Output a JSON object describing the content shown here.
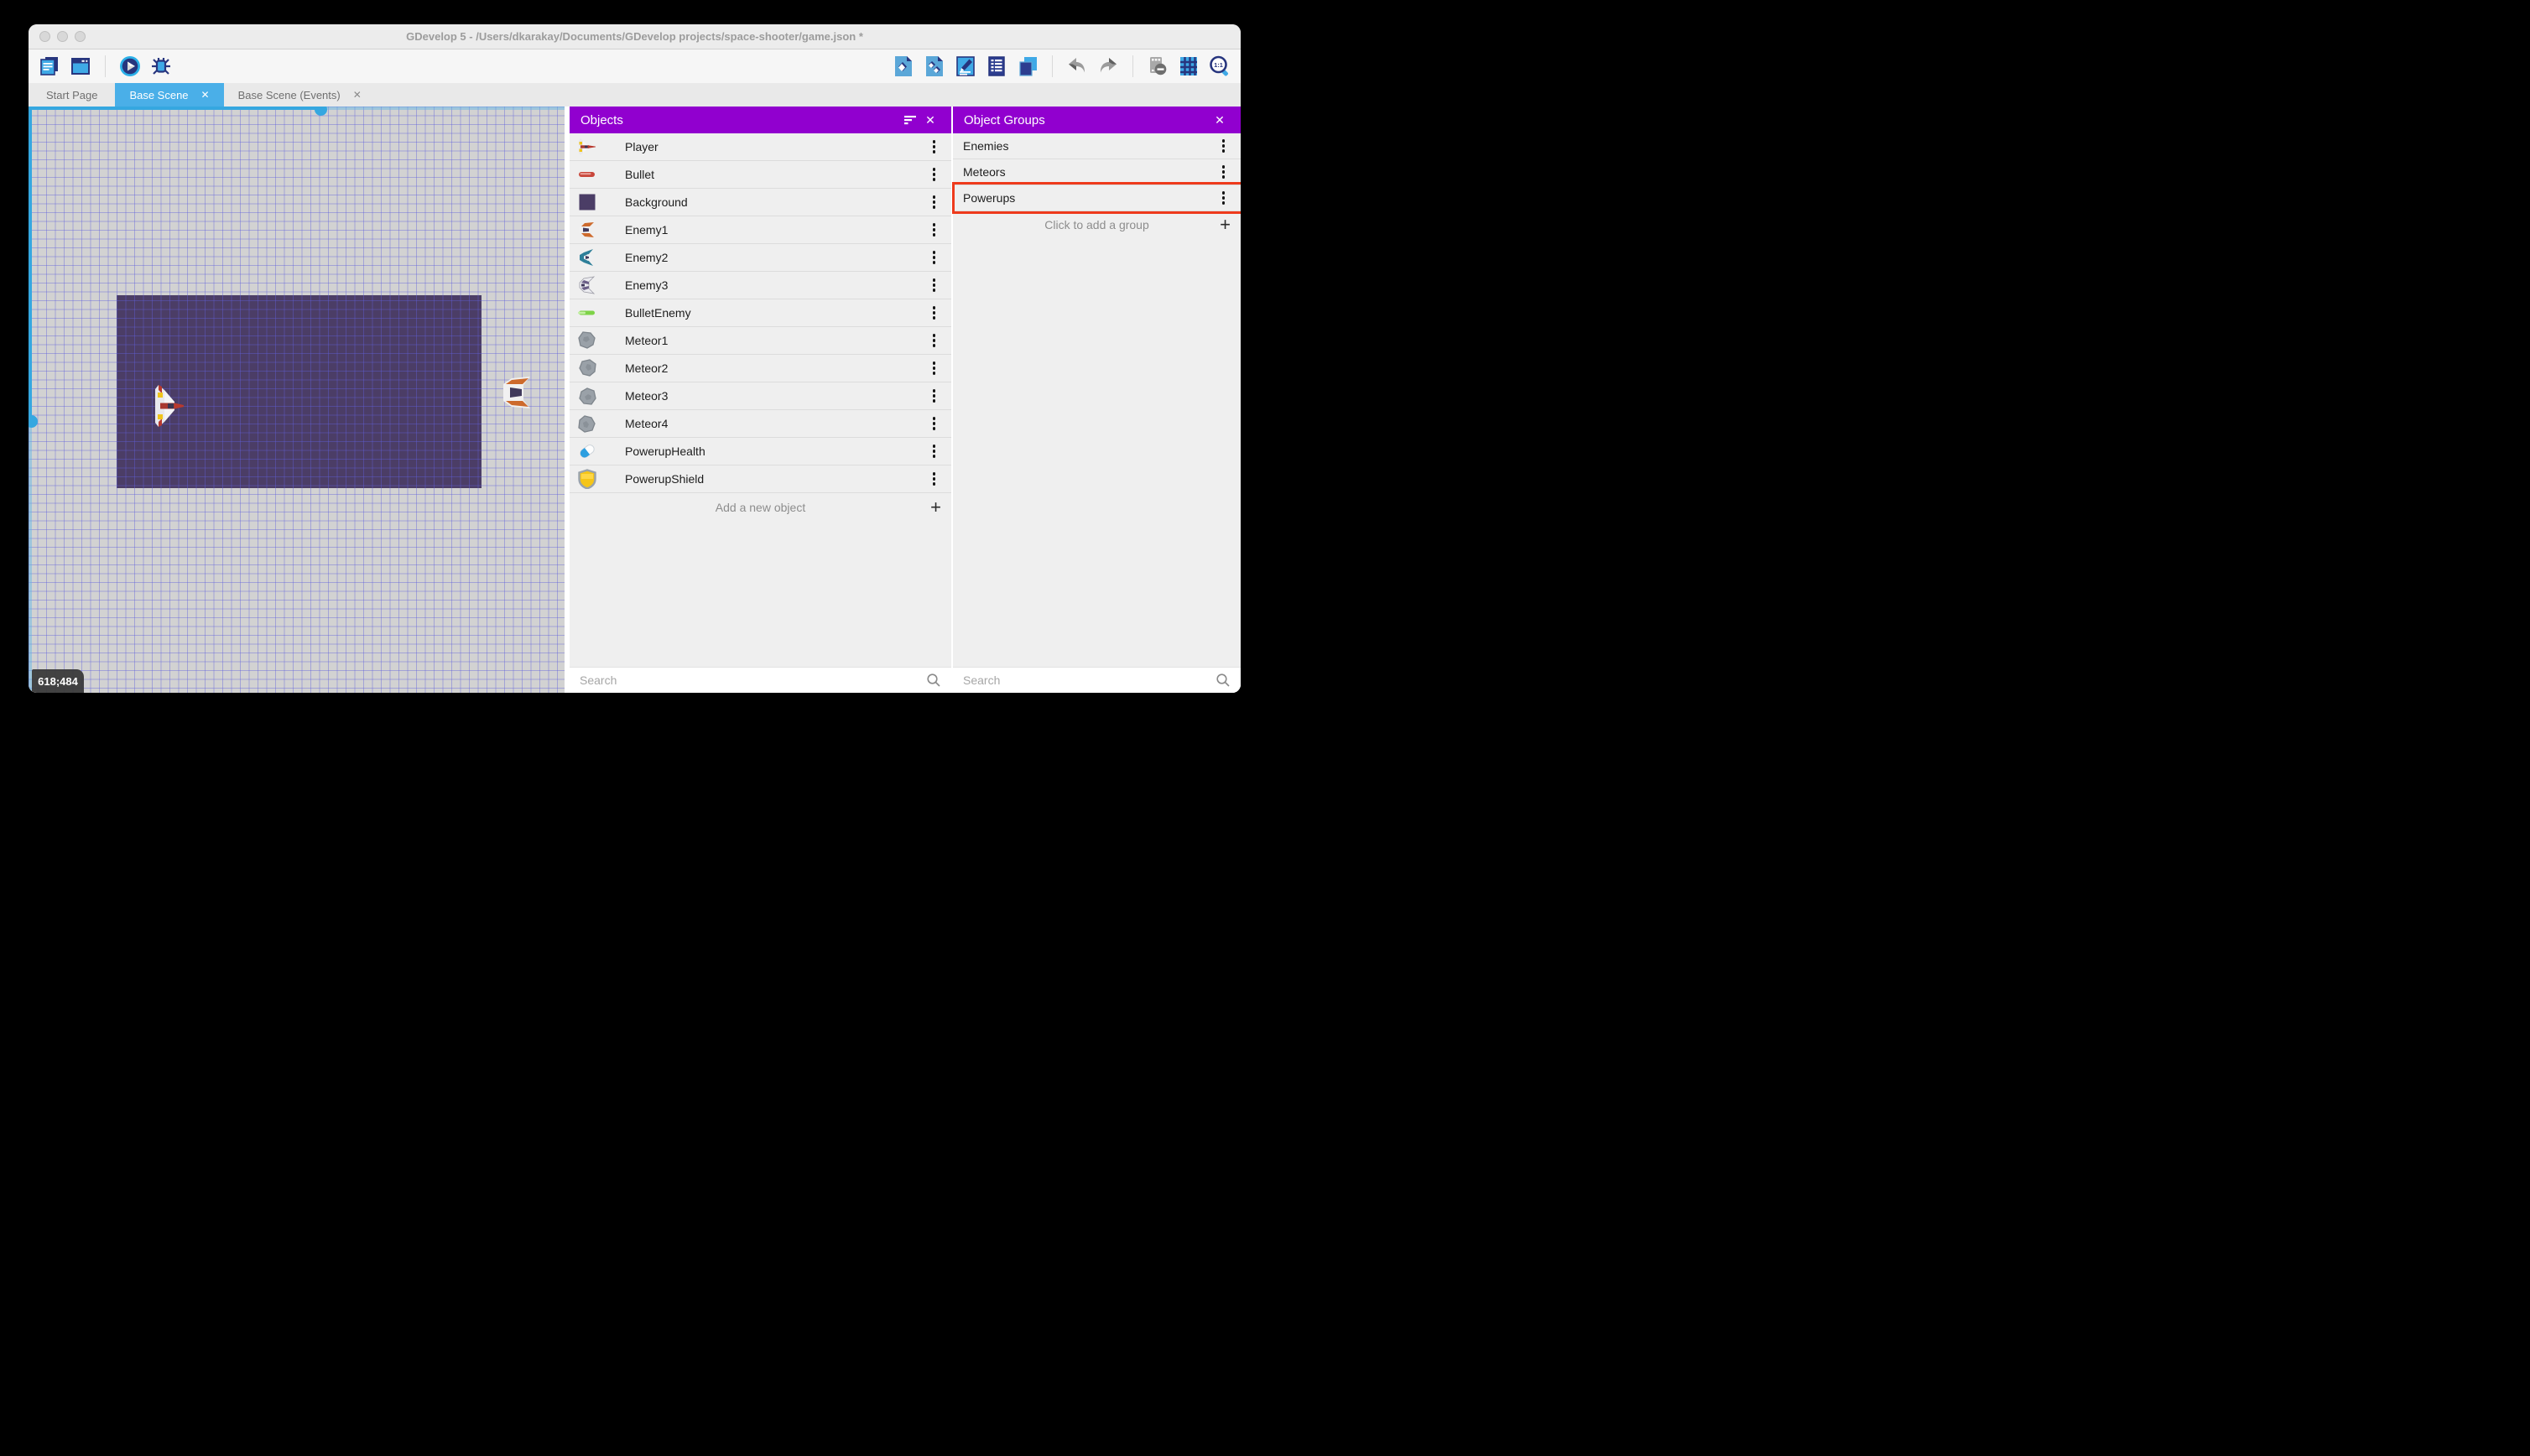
{
  "window": {
    "title": "GDevelop 5 - /Users/dkarakay/Documents/GDevelop projects/space-shooter/game.json *"
  },
  "toolbar": {
    "left_icons": [
      "project-manager-icon",
      "app-window-icon",
      "preview-play-icon",
      "debug-icon"
    ],
    "right_icons": [
      "objects-editor-icon",
      "object-groups-editor-icon",
      "properties-icon",
      "instances-list-icon",
      "layers-icon",
      "undo-icon",
      "redo-icon",
      "mask-toggle-icon",
      "grid-toggle-icon",
      "zoom-original-icon"
    ]
  },
  "tabs": {
    "items": [
      {
        "label": "Start Page",
        "active": false,
        "closable": false
      },
      {
        "label": "Base Scene",
        "active": true,
        "closable": true
      },
      {
        "label": "Base Scene (Events)",
        "active": false,
        "closable": true
      }
    ]
  },
  "scene": {
    "coordinates_label": "618;484",
    "instances": [
      "Player",
      "Enemy1",
      "Background"
    ]
  },
  "objects_panel": {
    "title": "Objects",
    "items": [
      {
        "label": "Player",
        "icon": "player-sprite-icon"
      },
      {
        "label": "Bullet",
        "icon": "bullet-sprite-icon"
      },
      {
        "label": "Background",
        "icon": "background-sprite-icon"
      },
      {
        "label": "Enemy1",
        "icon": "enemy1-sprite-icon"
      },
      {
        "label": "Enemy2",
        "icon": "enemy2-sprite-icon"
      },
      {
        "label": "Enemy3",
        "icon": "enemy3-sprite-icon"
      },
      {
        "label": "BulletEnemy",
        "icon": "bullet-enemy-sprite-icon"
      },
      {
        "label": "Meteor1",
        "icon": "meteor-sprite-icon"
      },
      {
        "label": "Meteor2",
        "icon": "meteor-sprite-icon"
      },
      {
        "label": "Meteor3",
        "icon": "meteor-sprite-icon"
      },
      {
        "label": "Meteor4",
        "icon": "meteor-sprite-icon"
      },
      {
        "label": "PowerupHealth",
        "icon": "powerup-health-sprite-icon"
      },
      {
        "label": "PowerupShield",
        "icon": "powerup-shield-sprite-icon"
      }
    ],
    "add_label": "Add a new object",
    "search_placeholder": "Search"
  },
  "object_groups_panel": {
    "title": "Object Groups",
    "items": [
      {
        "label": "Enemies"
      },
      {
        "label": "Meteors"
      },
      {
        "label": "Powerups",
        "highlighted": true
      }
    ],
    "add_label": "Click to add a group",
    "search_placeholder": "Search"
  },
  "ui_glyphs": {
    "close": "✕",
    "plus": "+"
  },
  "colors": {
    "panel_header": "#9100cf",
    "active_tab": "#4aafe8",
    "highlight_border": "#ee3a1c",
    "scrollbar": "#35a7e0"
  }
}
